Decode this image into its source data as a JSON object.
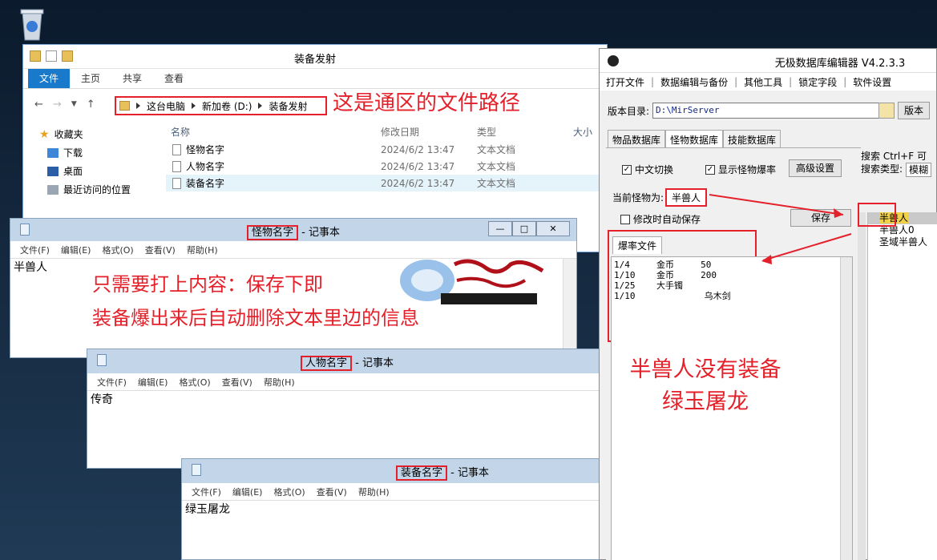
{
  "explorer": {
    "title": "装备发射",
    "ribbon_tabs": [
      "文件",
      "主页",
      "共享",
      "查看"
    ],
    "breadcrumb": [
      "这台电脑",
      "新加卷 (D:)",
      "装备发射"
    ],
    "nav": [
      "收藏夹",
      "下载",
      "桌面",
      "最近访问的位置"
    ],
    "columns": [
      "名称",
      "修改日期",
      "类型",
      "大小"
    ],
    "files": [
      {
        "name": "怪物名字",
        "date": "2024/6/2 13:47",
        "type": "文本文档"
      },
      {
        "name": "人物名字",
        "date": "2024/6/2 13:47",
        "type": "文本文档"
      },
      {
        "name": "装备名字",
        "date": "2024/6/2 13:47",
        "type": "文本文档"
      }
    ]
  },
  "annotations": {
    "path_note": "这是通区的文件路径",
    "note_line1": "只需要打上内容：保存下即",
    "note_line2": "装备爆出来后自动删除文本里边的信息",
    "no_equip_line1": "半兽人没有装备",
    "no_equip_line2": "绿玉屠龙"
  },
  "notepad1": {
    "file": "怪物名字",
    "suffix": " - 记事本",
    "content": "半兽人"
  },
  "notepad2": {
    "file": "人物名字",
    "suffix": " - 记事本",
    "content": "传奇"
  },
  "notepad3": {
    "file": "装备名字",
    "suffix": " - 记事本",
    "content": "绿玉屠龙"
  },
  "notepad_menu": [
    "文件(F)",
    "编辑(E)",
    "格式(O)",
    "查看(V)",
    "帮助(H)"
  ],
  "editor": {
    "title": "无极数据库编辑器 V4.2.3.3",
    "menu": [
      "打开文件",
      "数据编辑与备份",
      "其他工具",
      "锁定字段",
      "软件设置"
    ],
    "version_label": "版本目录:",
    "version_path": "D:\\MirServer",
    "version_btn": "版本",
    "tabs": [
      "物品数据库",
      "怪物数据库",
      "技能数据库"
    ],
    "chk_chinese": "中文切换",
    "chk_droprate": "显示怪物爆率",
    "advanced_btn": "高级设置",
    "search_label": "搜索  Ctrl+F 可",
    "search_type_label": "搜索类型:",
    "search_type_value": "模糊",
    "current_label": "当前怪物为:",
    "current_value": "半兽人",
    "autosave": "修改时自动保存",
    "save_btn": "保存",
    "drop_tab": "爆率文件",
    "drops": "1/4     金币     50\n1/10    金币     200\n1/25    大手镯\n1/10             乌木剑",
    "list": [
      "半兽人",
      "半兽人0",
      "圣域半兽人"
    ]
  }
}
